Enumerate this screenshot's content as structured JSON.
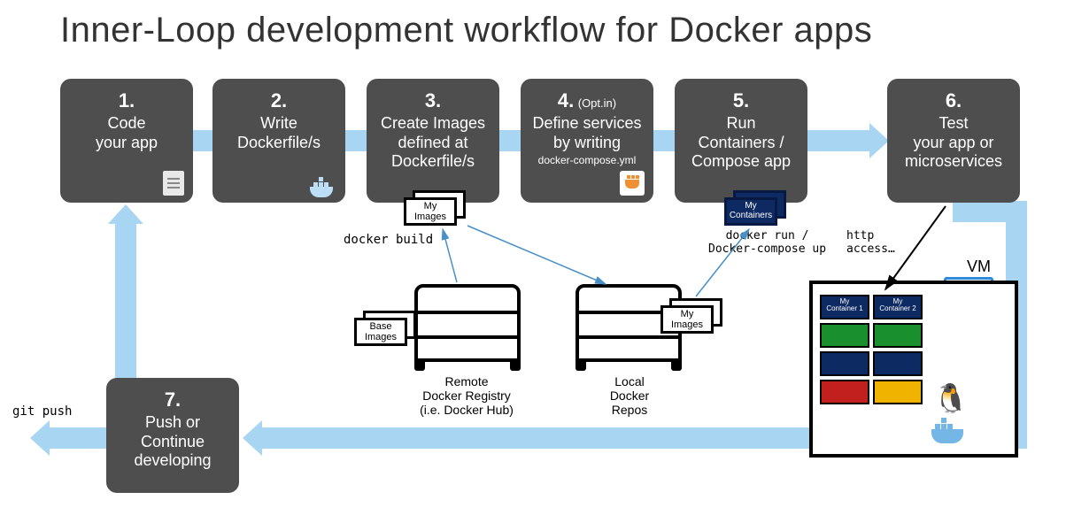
{
  "title": "Inner-Loop development workflow for Docker apps",
  "steps": {
    "s1": {
      "num": "1.",
      "label": "Code\nyour app"
    },
    "s2": {
      "num": "2.",
      "label": "Write\nDockerfile/s"
    },
    "s3": {
      "num": "3.",
      "label": "Create Images\ndefined at\nDockerfile/s"
    },
    "s4": {
      "num": "4.",
      "opt": "(Opt.in)",
      "label": "Define services\nby writing",
      "sub": "docker-compose.yml"
    },
    "s5": {
      "num": "5.",
      "label": "Run\nContainers /\nCompose app"
    },
    "s6": {
      "num": "6.",
      "label": "Test\nyour app or\nmicroservices"
    },
    "s7": {
      "num": "7.",
      "label": "Push or\nContinue\ndeveloping"
    }
  },
  "labels": {
    "docker_build": "docker build",
    "docker_run": "docker run /\nDocker-compose up",
    "http_access": "http\naccess…",
    "git_push": "git push",
    "vm": "VM",
    "remote_registry": "Remote\nDocker Registry\n(i.e. Docker Hub)",
    "local_repos": "Local\nDocker\nRepos"
  },
  "stacks": {
    "my_images_top": "My\nImages",
    "base_images": "Base\nImages",
    "my_images_local": "My\nImages",
    "my_containers": "My\nContainers"
  },
  "vm_containers": {
    "c1": "My\nContainer 1",
    "c2": "My\nContainer 2"
  }
}
